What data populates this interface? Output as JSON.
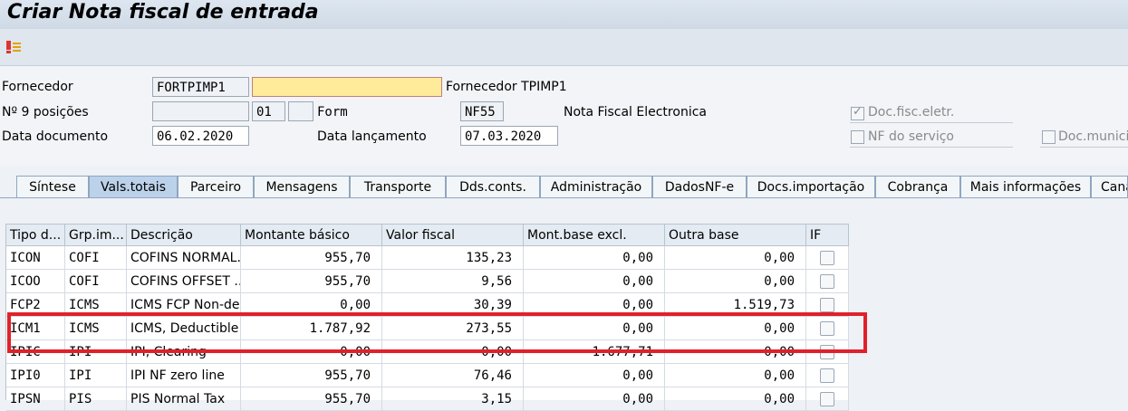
{
  "window": {
    "title": "Criar Nota fiscal de entrada"
  },
  "toolbar": {
    "icon": "header-details-icon"
  },
  "header": {
    "fornecedor_label": "Fornecedor",
    "fornecedor_value": "FORTPIMP1",
    "fornecedor_input_value": "",
    "fornecedor_name": "Fornecedor TPIMP1",
    "nr9_label": "Nº 9 posições",
    "nr9_value": "",
    "serie_value": "01",
    "subserie_value": "",
    "form_label": "Form",
    "form_value": "NF55",
    "form_desc": "Nota Fiscal Electronica",
    "data_doc_label": "Data documento",
    "data_doc_value": "06.02.2020",
    "data_lanc_label": "Data lançamento",
    "data_lanc_value": "07.03.2020",
    "doc_fisc_eletr_label": "Doc.fisc.eletr.",
    "doc_fisc_eletr_checked": true,
    "nf_servico_label": "NF do serviço",
    "nf_servico_checked": false,
    "doc_municip_label": "Doc.municip"
  },
  "tabs": [
    {
      "label": "Síntese",
      "active": false
    },
    {
      "label": "Vals.totais",
      "active": true
    },
    {
      "label": "Parceiro",
      "active": false
    },
    {
      "label": "Mensagens",
      "active": false
    },
    {
      "label": "Transporte",
      "active": false
    },
    {
      "label": "Dds.conts.",
      "active": false
    },
    {
      "label": "Administração",
      "active": false
    },
    {
      "label": "DadosNF-e",
      "active": false
    },
    {
      "label": "Docs.importação",
      "active": false
    },
    {
      "label": "Cobrança",
      "active": false
    },
    {
      "label": "Mais informações",
      "active": false
    },
    {
      "label": "Cana",
      "active": false
    }
  ],
  "table": {
    "columns": [
      "Tipo d...",
      "Grp.im...",
      "Descrição",
      "Montante básico",
      "Valor fiscal",
      "Mont.base excl.",
      "Outra base",
      "IF"
    ],
    "rows": [
      {
        "tipo": "ICON",
        "grp": "COFI",
        "desc": "COFINS NORMAL...",
        "montante": "955,70",
        "valor": "135,23",
        "excl": "0,00",
        "outra": "0,00",
        "if": false
      },
      {
        "tipo": "ICOO",
        "grp": "COFI",
        "desc": "COFINS OFFSET ...",
        "montante": "955,70",
        "valor": "9,56",
        "excl": "0,00",
        "outra": "0,00",
        "if": false
      },
      {
        "tipo": "FCP2",
        "grp": "ICMS",
        "desc": "ICMS FCP Non-de...",
        "montante": "0,00",
        "valor": "30,39",
        "excl": "0,00",
        "outra": "1.519,73",
        "if": false
      },
      {
        "tipo": "ICM1",
        "grp": "ICMS",
        "desc": "ICMS, Deductible",
        "montante": "1.787,92",
        "valor": "273,55",
        "excl": "0,00",
        "outra": "0,00",
        "if": false
      },
      {
        "tipo": "IPIC",
        "grp": "IPI",
        "desc": "IPI, Clearing",
        "montante": "0,00",
        "valor": "0,00",
        "excl": "1.677,71",
        "outra": "0,00",
        "if": false
      },
      {
        "tipo": "IPI0",
        "grp": "IPI",
        "desc": "IPI NF zero line",
        "montante": "955,70",
        "valor": "76,46",
        "excl": "0,00",
        "outra": "0,00",
        "if": false
      },
      {
        "tipo": "IPSN",
        "grp": "PIS",
        "desc": "PIS Normal Tax",
        "montante": "955,70",
        "valor": "3,15",
        "excl": "0,00",
        "outra": "0,00",
        "if": false
      }
    ]
  },
  "colors": {
    "highlight": "#e0212b",
    "active_tab": "#bcd2ea",
    "required_field": "#ffeb99"
  }
}
